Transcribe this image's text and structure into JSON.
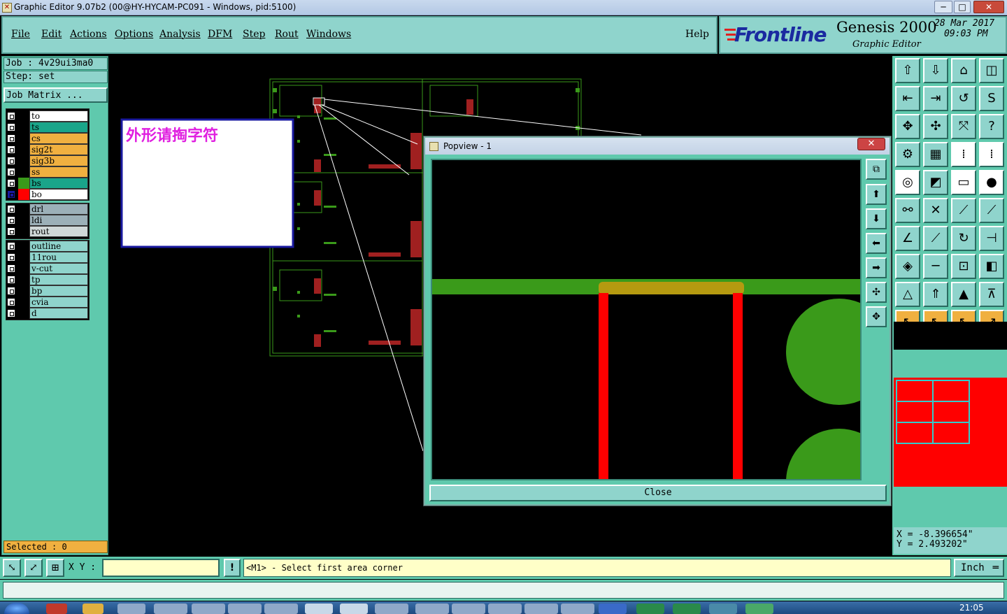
{
  "window": {
    "title": "Graphic Editor 9.07b2 (00@HY-HYCAM-PC091 - Windows, pid:5100)",
    "min": "─",
    "max": "□",
    "close": "✕"
  },
  "menu": {
    "items": [
      "File",
      "Edit",
      "Actions",
      "Options",
      "Analysis",
      "DFM",
      "Step",
      "Rout",
      "Windows"
    ],
    "help": "Help"
  },
  "brand": {
    "logo": "Frontline",
    "product": "Genesis 2000",
    "subtitle": "Graphic Editor",
    "date": "28 Mar 2017",
    "time": "09:03 PM"
  },
  "job": {
    "job_label": "Job  : 4v29ui3ma0",
    "step_label": "Step: set",
    "matrix_button": "Job Matrix ..."
  },
  "layers": {
    "board": [
      {
        "name": "to",
        "swatch": "#000000",
        "fill": "#ffffff"
      },
      {
        "name": "ts",
        "swatch": "#000000",
        "fill": "#1aa58a"
      },
      {
        "name": "cs",
        "swatch": "#000000",
        "fill": "#f0b040"
      },
      {
        "name": "sig2t",
        "swatch": "#000000",
        "fill": "#f0b040"
      },
      {
        "name": "sig3b",
        "swatch": "#000000",
        "fill": "#f0b040"
      },
      {
        "name": "ss",
        "swatch": "#000000",
        "fill": "#f0b040"
      },
      {
        "name": "bs",
        "swatch": "#3a9a1a",
        "fill": "#1aa58a"
      },
      {
        "name": "bo",
        "swatch": "#ff0000",
        "fill": "#ffffff"
      }
    ],
    "drill": [
      {
        "name": "drl",
        "fill": "#9cb0b8"
      },
      {
        "name": "ldi",
        "fill": "#9cb0b8"
      },
      {
        "name": "rout",
        "fill": "#d0d8d8"
      }
    ],
    "misc": [
      {
        "name": "outline",
        "fill": "#8fd4cc"
      },
      {
        "name": "11rou",
        "fill": "#8fd4cc"
      },
      {
        "name": "v-cut",
        "fill": "#8fd4cc"
      },
      {
        "name": "tp",
        "fill": "#8fd4cc"
      },
      {
        "name": "bp",
        "fill": "#8fd4cc"
      },
      {
        "name": "cvia",
        "fill": "#8fd4cc"
      },
      {
        "name": "d",
        "fill": "#8fd4cc"
      }
    ]
  },
  "selected": "Selected : 0",
  "note": {
    "text": "外形请掏字符",
    "color": "#e020e0"
  },
  "popview": {
    "title": "Popview - 1",
    "close_x": "✕",
    "close_button": "Close"
  },
  "coords": {
    "x": "X = -8.396654\"",
    "y": "Y = 2.493202\""
  },
  "status": {
    "xy_label": "X Y :",
    "xy_value": "",
    "alert": "!",
    "prompt": "<M1> - Select first area corner",
    "units": "Inch"
  },
  "taskbar": {
    "clock": "21:05"
  },
  "colors": {
    "panel": "#5fc9ad",
    "panel_light": "#8fd4cc",
    "pcb_green": "#3a9a1a",
    "pcb_red": "#ff0000"
  }
}
